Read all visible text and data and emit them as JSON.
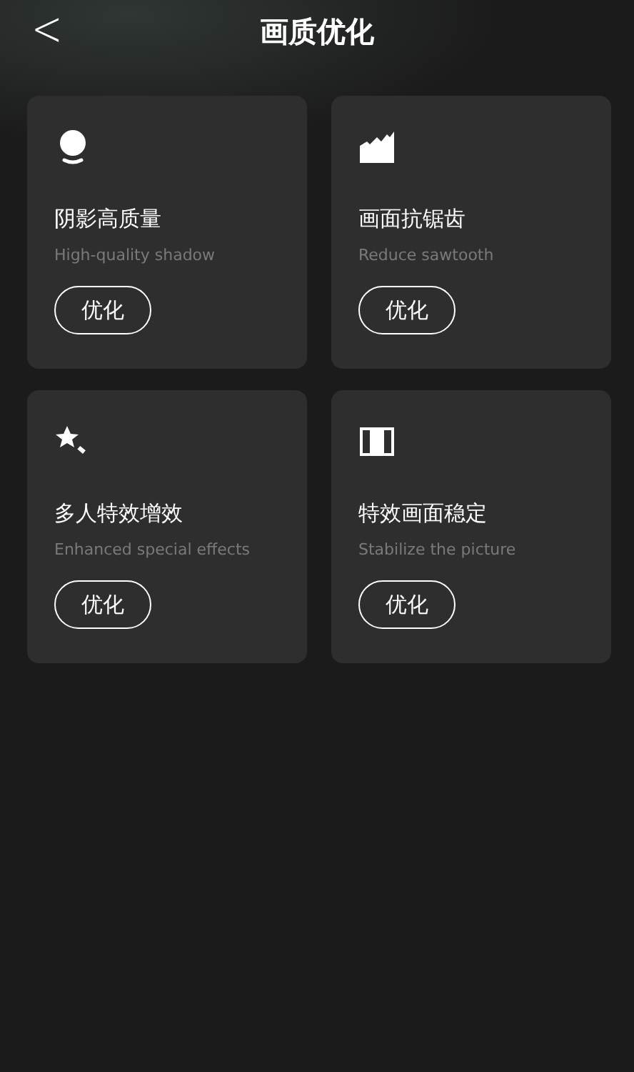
{
  "header": {
    "back": "<",
    "title": "画质优化"
  },
  "cards": [
    {
      "title": "阴影高质量",
      "subtitle": "High-quality shadow",
      "button": "优化"
    },
    {
      "title": "画面抗锯齿",
      "subtitle": "Reduce sawtooth",
      "button": "优化"
    },
    {
      "title": "多人特效增效",
      "subtitle": "Enhanced special effects",
      "button": "优化"
    },
    {
      "title": "特效画面稳定",
      "subtitle": "Stabilize the picture",
      "button": "优化"
    }
  ]
}
